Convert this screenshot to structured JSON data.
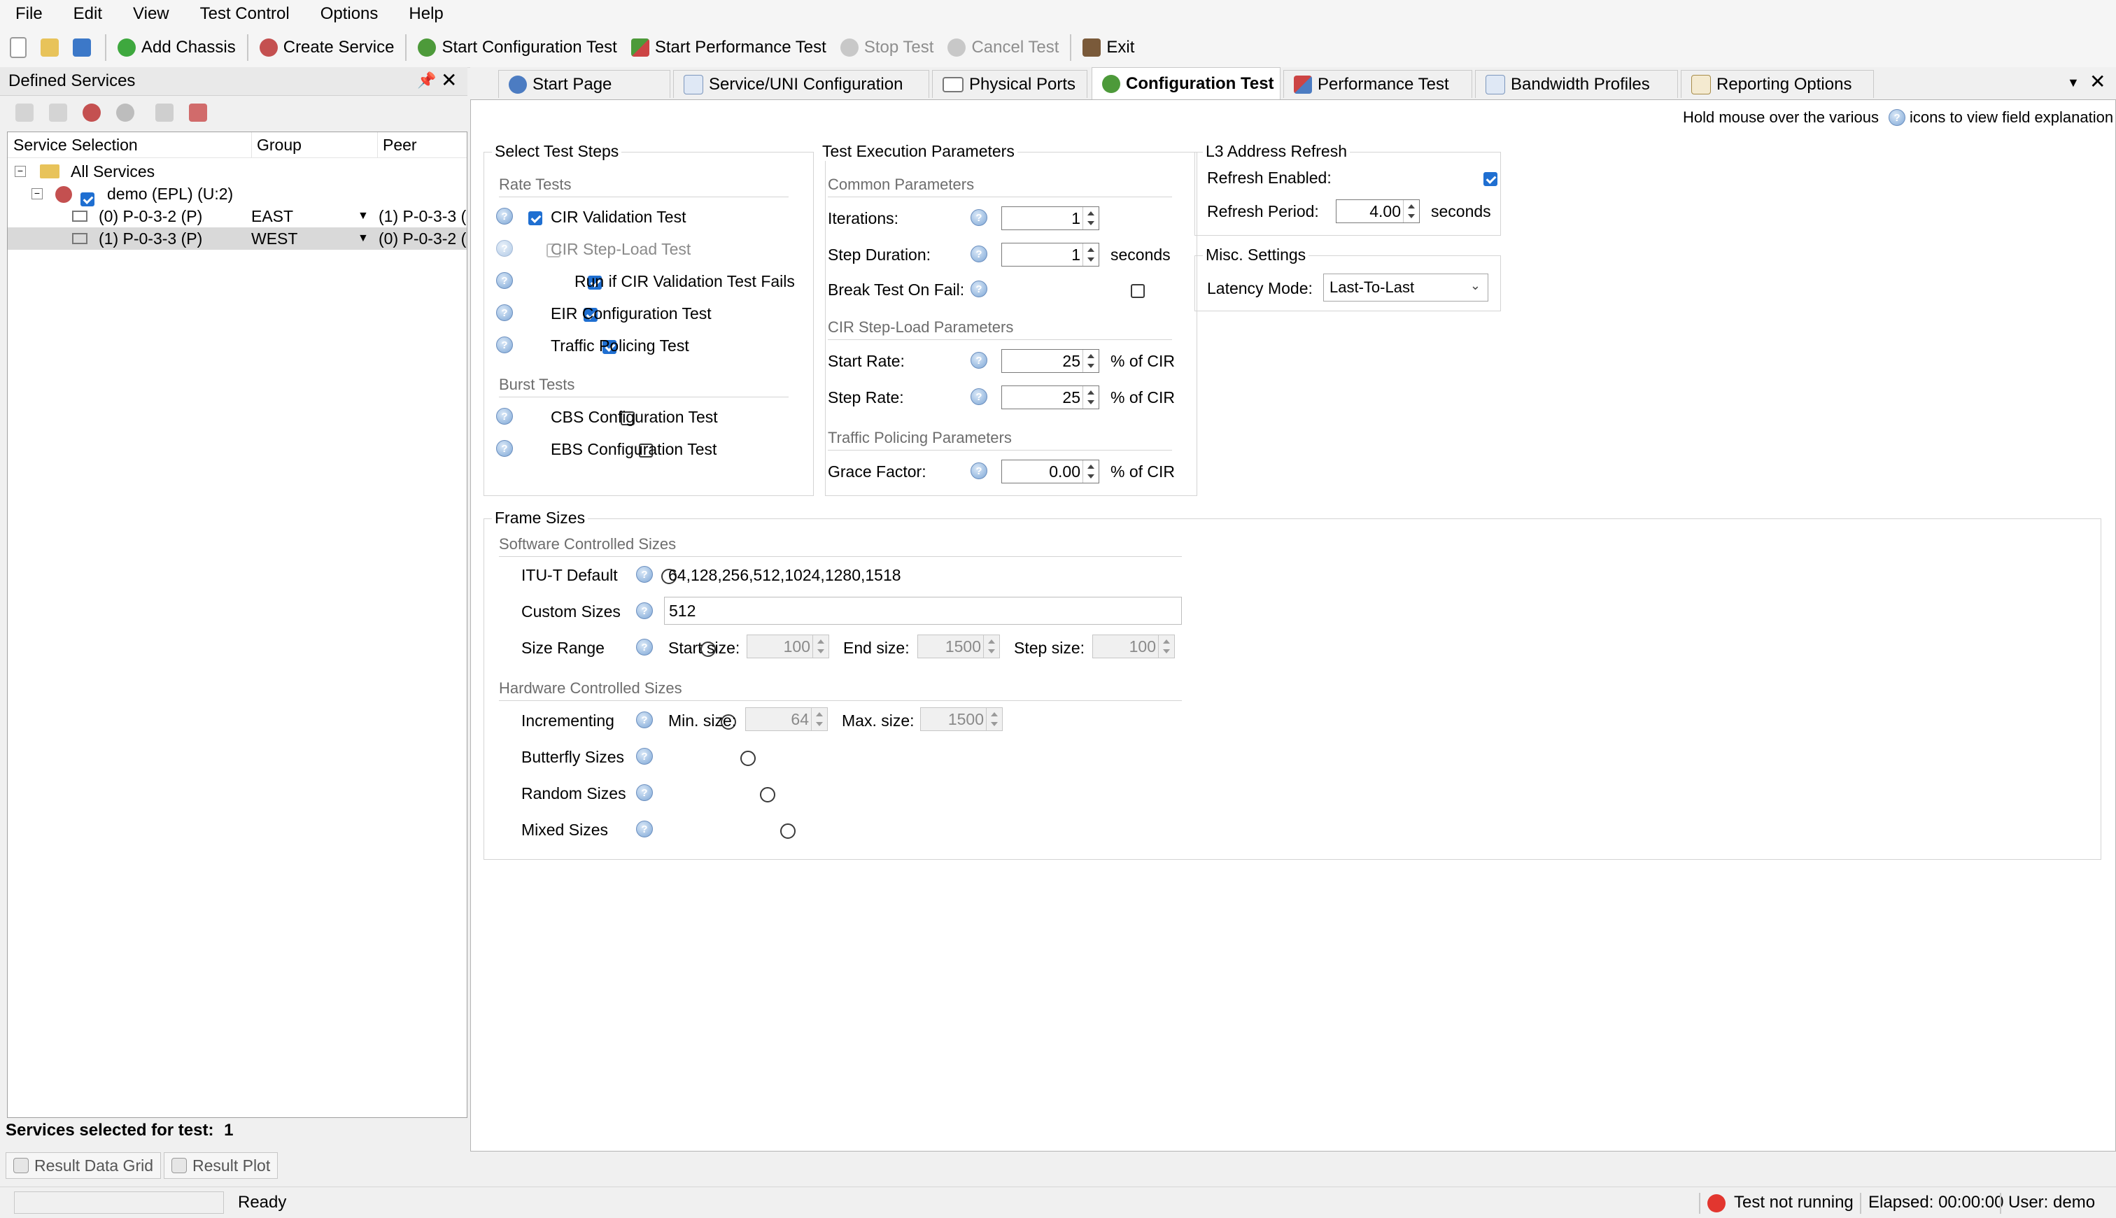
{
  "menu": [
    "File",
    "Edit",
    "View",
    "Test Control",
    "Options",
    "Help"
  ],
  "toolbar": {
    "add_chassis": "Add Chassis",
    "create_service": "Create Service",
    "start_config": "Start Configuration Test",
    "start_perf": "Start Performance Test",
    "stop_test": "Stop Test",
    "cancel_test": "Cancel Test",
    "exit": "Exit"
  },
  "left": {
    "title": "Defined Services",
    "columns": [
      "Service Selection",
      "Group",
      "Peer"
    ],
    "root": "All Services",
    "service": "demo (EPL) (U:2)",
    "rows": [
      {
        "name": "(0) P-0-3-2 (P)",
        "group": "EAST",
        "peer": "(1) P-0-3-3 ("
      },
      {
        "name": "(1) P-0-3-3 (P)",
        "group": "WEST",
        "peer": "(0) P-0-3-2 ("
      }
    ],
    "selected_label": "Services selected for test:",
    "selected_count": "1",
    "bottom_tabs": [
      "Result Data Grid",
      "Result Plot"
    ]
  },
  "tabs": [
    "Start Page",
    "Service/UNI Configuration",
    "Physical Ports",
    "Configuration Test",
    "Performance Test",
    "Bandwidth Profiles",
    "Reporting Options"
  ],
  "hint": {
    "pre": "Hold mouse over the various",
    "post": "icons to view field explanation"
  },
  "steps": {
    "title": "Select Test Steps",
    "rate_title": "Rate Tests",
    "cir_validation": "CIR Validation Test",
    "cir_stepload": "CIR Step-Load Test",
    "run_if_fail": "Run if CIR Validation Test Fails",
    "eir": "EIR Configuration Test",
    "policing": "Traffic Policing Test",
    "burst_title": "Burst Tests",
    "cbs": "CBS Configuration Test",
    "ebs": "EBS Configuration Test"
  },
  "exec": {
    "title": "Test Execution Parameters",
    "common_title": "Common Parameters",
    "iterations_label": "Iterations:",
    "iterations": "1",
    "step_duration_label": "Step Duration:",
    "step_duration": "1",
    "seconds": "seconds",
    "break_label": "Break Test On Fail:",
    "cir_title": "CIR Step-Load Parameters",
    "start_rate_label": "Start Rate:",
    "start_rate": "25",
    "step_rate_label": "Step Rate:",
    "step_rate": "25",
    "pct_cir": "% of CIR",
    "policing_title": "Traffic Policing Parameters",
    "grace_label": "Grace Factor:",
    "grace": "0.00"
  },
  "l3": {
    "title": "L3 Address Refresh",
    "enabled_label": "Refresh Enabled:",
    "period_label": "Refresh Period:",
    "period": "4.00",
    "seconds": "seconds"
  },
  "misc": {
    "title": "Misc. Settings",
    "latency_label": "Latency Mode:",
    "latency": "Last-To-Last"
  },
  "frames": {
    "title": "Frame Sizes",
    "sw_title": "Software Controlled Sizes",
    "itu_label": "ITU-T Default",
    "itu_value": "64,128,256,512,1024,1280,1518",
    "custom_label": "Custom Sizes",
    "custom_value": "512",
    "range_label": "Size Range",
    "start_size_label": "Start size:",
    "start_size": "100",
    "end_size_label": "End size:",
    "end_size": "1500",
    "step_size_label": "Step size:",
    "step_size": "100",
    "hw_title": "Hardware Controlled Sizes",
    "incr_label": "Incrementing",
    "min_label": "Min. size:",
    "min": "64",
    "max_label": "Max. size:",
    "max": "1500",
    "butterfly": "Butterfly Sizes",
    "random": "Random Sizes",
    "mixed": "Mixed Sizes"
  },
  "status": {
    "ready": "Ready",
    "test_state": "Test not running",
    "elapsed": "Elapsed: 00:00:00",
    "user": "User: demo"
  },
  "colors": {
    "accent": "#1f6fd1",
    "selection": "#d9d9d9",
    "stop_red": "#e2362f"
  }
}
